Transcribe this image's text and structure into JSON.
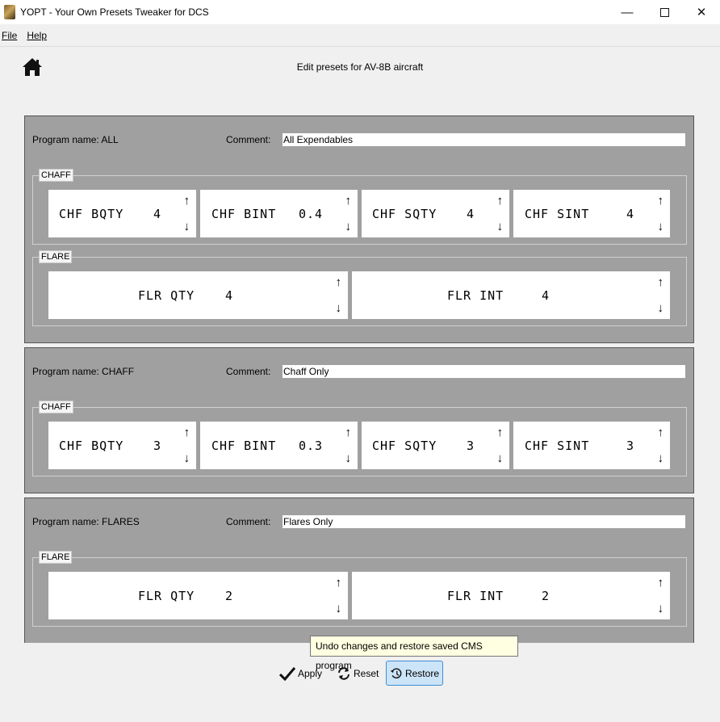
{
  "window": {
    "title": "YOPT - Your Own Presets Tweaker for DCS",
    "min_icon": "minimize-icon",
    "max_icon": "maximize-icon",
    "close_icon": "close-icon"
  },
  "menu": {
    "file": "File",
    "help": "Help"
  },
  "header": {
    "home_icon": "home-icon",
    "title": "Edit presets for AV-8B aircraft"
  },
  "programs": [
    {
      "name": "Program name: ALL",
      "comment_label": "Comment:",
      "comment": "All Expendables",
      "chaff": {
        "label": "CHAFF",
        "fields": [
          {
            "label": "CHF BQTY",
            "value": "4"
          },
          {
            "label": "CHF BINT",
            "value": "0.4"
          },
          {
            "label": "CHF SQTY",
            "value": "4"
          },
          {
            "label": "CHF SINT",
            "value": "4"
          }
        ]
      },
      "flare": {
        "label": "FLARE",
        "fields": [
          {
            "label": "FLR QTY",
            "value": "4"
          },
          {
            "label": "FLR INT",
            "value": "4"
          }
        ]
      }
    },
    {
      "name": "Program name: CHAFF",
      "comment_label": "Comment:",
      "comment": "Chaff Only",
      "chaff": {
        "label": "CHAFF",
        "fields": [
          {
            "label": "CHF BQTY",
            "value": "3"
          },
          {
            "label": "CHF BINT",
            "value": "0.3"
          },
          {
            "label": "CHF SQTY",
            "value": "3"
          },
          {
            "label": "CHF SINT",
            "value": "3"
          }
        ]
      }
    },
    {
      "name": "Program name: FLARES",
      "comment_label": "Comment:",
      "comment": "Flares Only",
      "flare": {
        "label": "FLARE",
        "fields": [
          {
            "label": "FLR QTY",
            "value": "2"
          },
          {
            "label": "FLR INT",
            "value": "2"
          }
        ]
      }
    }
  ],
  "arrows": {
    "up": "↑",
    "down": "↓"
  },
  "tooltip": "Undo changes and restore saved CMS program",
  "buttons": {
    "apply": "Apply",
    "reset": "Reset",
    "restore": "Restore"
  }
}
